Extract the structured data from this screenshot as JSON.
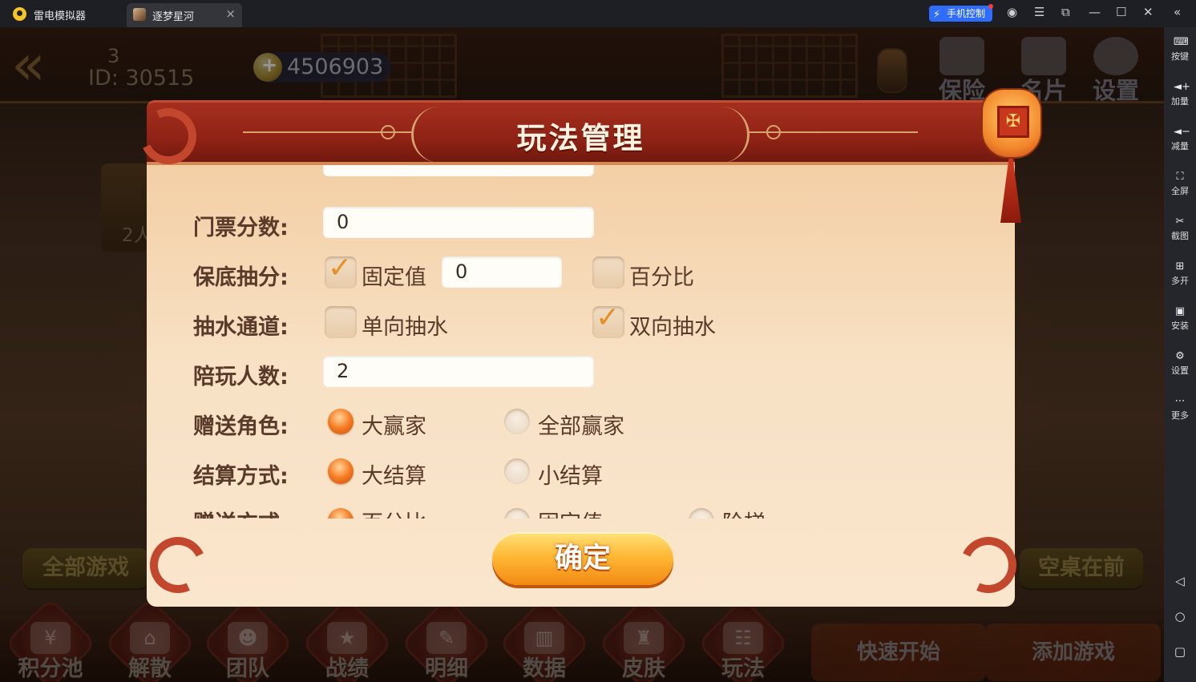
{
  "window": {
    "app_name": "雷电模拟器",
    "tab_label": "逐梦星河",
    "phone_control": "手机控制"
  },
  "sidebar": {
    "items": [
      "按键",
      "加量",
      "减量",
      "全屏",
      "截图",
      "多开",
      "安装",
      "设置",
      "更多"
    ]
  },
  "game": {
    "player_level": "3",
    "player_id": "ID: 30515",
    "coins": "4506903",
    "top_buttons": [
      "保险箱",
      "名片",
      "设置"
    ],
    "table_count": "2人",
    "all_games": "全部游戏",
    "empty_first": "空桌在前",
    "bottom_nav": [
      "积分池",
      "解散",
      "团队",
      "战绩",
      "明细",
      "数据",
      "皮肤",
      "玩法"
    ],
    "quick_start": "快速开始",
    "add_game": "添加游戏"
  },
  "dialog": {
    "title": "玩法管理",
    "rows": {
      "ticket": {
        "label": "门票分数:",
        "value": "0"
      },
      "min_rake": {
        "label": "保底抽分:",
        "option_a": "固定值",
        "option_a_checked": true,
        "fixed_value": "0",
        "option_b": "百分比",
        "option_b_checked": false
      },
      "rake_channel": {
        "label": "抽水通道:",
        "option_a": "单向抽水",
        "option_a_checked": false,
        "option_b": "双向抽水",
        "option_b_checked": true
      },
      "companions": {
        "label": "陪玩人数:",
        "value": "2"
      },
      "gift_role": {
        "label": "赠送角色:",
        "option_a": "大赢家",
        "option_b": "全部赢家",
        "selected": "大赢家"
      },
      "settlement": {
        "label": "结算方式:",
        "option_a": "大结算",
        "option_b": "小结算",
        "selected": "大结算"
      },
      "gift_method": {
        "label": "赠送方式:",
        "option_a": "百分比",
        "option_b": "固定值",
        "option_c": "阶梯",
        "selected": "百分比"
      }
    },
    "confirm": "确定"
  },
  "colors": {
    "dialog_header": "#8e2215",
    "dialog_body": "#f8e1c4",
    "confirm_button": "#ffb935",
    "checkmark": "#e58f24",
    "emulator_accent": "#2f6dff"
  }
}
